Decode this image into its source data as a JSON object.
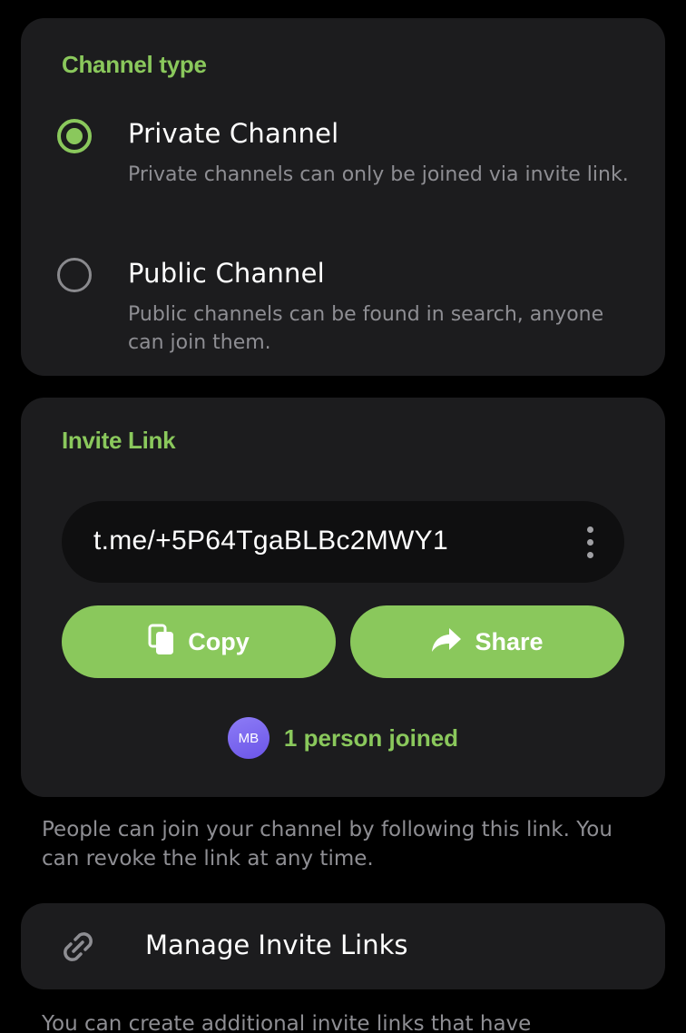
{
  "channel_type": {
    "title": "Channel type",
    "options": [
      {
        "label": "Private Channel",
        "description": "Private channels can only be joined via invite link.",
        "selected": true
      },
      {
        "label": "Public Channel",
        "description": "Public channels can be found in search, anyone can join them.",
        "selected": false
      }
    ]
  },
  "invite_link": {
    "title": "Invite Link",
    "url": "t.me/+5P64TgaBLBc2MWY1",
    "more_icon": "vertical-dots-icon",
    "copy_label": "Copy",
    "copy_icon": "copy-icon",
    "share_label": "Share",
    "share_icon": "share-arrow-icon",
    "joined": {
      "avatar_initials": "MB",
      "text": "1 person joined"
    }
  },
  "invite_footer": "People can join your channel by following this link. You can revoke the link at any time.",
  "manage": {
    "label": "Manage Invite Links",
    "icon": "link-icon"
  },
  "manage_footer": "You can create additional invite links that have",
  "colors": {
    "background": "#000000",
    "card": "#1c1c1e",
    "accent": "#8ac85c",
    "secondary_text": "#8e8e93",
    "link_box": "#0f0f10",
    "avatar": "#7a66f0"
  }
}
